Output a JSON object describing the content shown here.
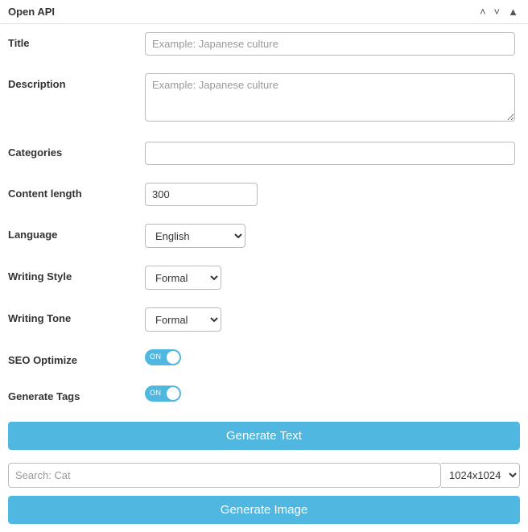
{
  "panel": {
    "title": "Open API"
  },
  "form": {
    "title": {
      "label": "Title",
      "placeholder": "Example: Japanese culture"
    },
    "description": {
      "label": "Description",
      "placeholder": "Example: Japanese culture"
    },
    "categories": {
      "label": "Categories",
      "value": ""
    },
    "content_length": {
      "label": "Content length",
      "value": "300"
    },
    "language": {
      "label": "Language",
      "value": "English",
      "options": [
        "English"
      ]
    },
    "writing_style": {
      "label": "Writing Style",
      "value": "Formal",
      "options": [
        "Formal"
      ]
    },
    "writing_tone": {
      "label": "Writing Tone",
      "value": "Formal",
      "options": [
        "Formal"
      ]
    },
    "seo_optimize": {
      "label": "SEO Optimize",
      "state": "ON"
    },
    "generate_tags": {
      "label": "Generate Tags",
      "state": "ON"
    }
  },
  "actions": {
    "generate_text": "Generate Text",
    "generate_image": "Generate Image"
  },
  "image": {
    "search_placeholder": "Search: Cat",
    "size": "1024x1024",
    "size_options": [
      "1024x1024"
    ]
  },
  "colors": {
    "accent": "#4fb7e0"
  }
}
